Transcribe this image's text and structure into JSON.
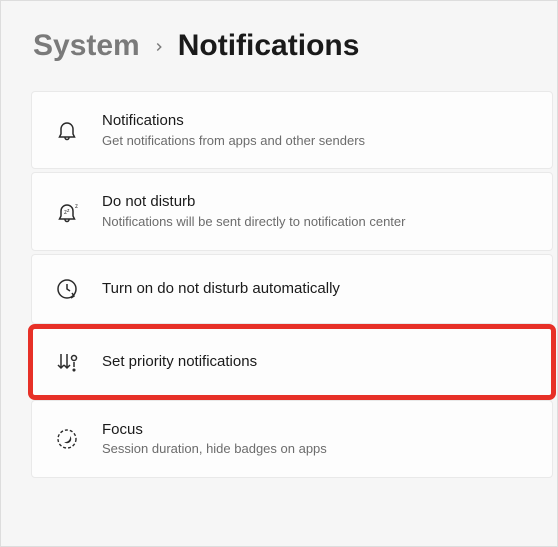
{
  "breadcrumb": {
    "parent": "System",
    "current": "Notifications"
  },
  "items": [
    {
      "title": "Notifications",
      "subtitle": "Get notifications from apps and other senders"
    },
    {
      "title": "Do not disturb",
      "subtitle": "Notifications will be sent directly to notification center"
    },
    {
      "title": "Turn on do not disturb automatically",
      "subtitle": ""
    },
    {
      "title": "Set priority notifications",
      "subtitle": ""
    },
    {
      "title": "Focus",
      "subtitle": "Session duration, hide badges on apps"
    }
  ],
  "highlighted_index": 3
}
